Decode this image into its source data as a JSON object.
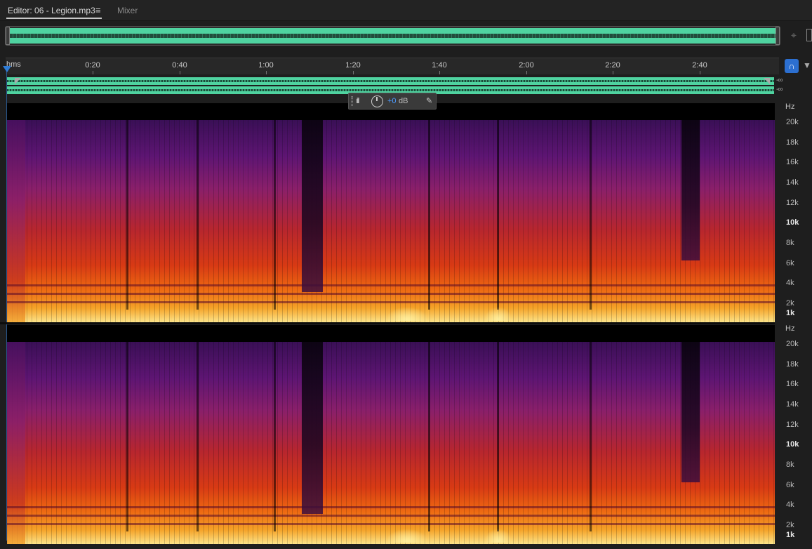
{
  "tabs": {
    "editor_label": "Editor: 06 - Legion.mp3",
    "menu_glyph": "≡",
    "mixer_label": "Mixer"
  },
  "ruler": {
    "unit_label": "hms",
    "ticks": [
      "0:20",
      "0:40",
      "1:00",
      "1:20",
      "1:40",
      "2:00",
      "2:20",
      "2:40"
    ]
  },
  "channels": {
    "volume_readout": "-∞"
  },
  "hud": {
    "meter_glyph": "ılıll",
    "value": "+0",
    "unit": "dB"
  },
  "freq_axis": {
    "unit": "Hz",
    "labels": [
      "20k",
      "18k",
      "16k",
      "14k",
      "12k",
      "10k",
      "8k",
      "6k",
      "4k",
      "2k",
      "1k"
    ],
    "strong_labels": [
      "10k",
      "1k"
    ]
  },
  "icons": {
    "zoom": "crosshair-zoom-icon",
    "snap": "snap-magnet-icon",
    "marker": "marker-pin-icon",
    "pin": "pin-icon",
    "volume_knob": "volume-knob-icon"
  },
  "colors": {
    "accent": "#2e7cd6",
    "waveform": "#4fd3a0",
    "hud_value": "#4d9bff"
  }
}
